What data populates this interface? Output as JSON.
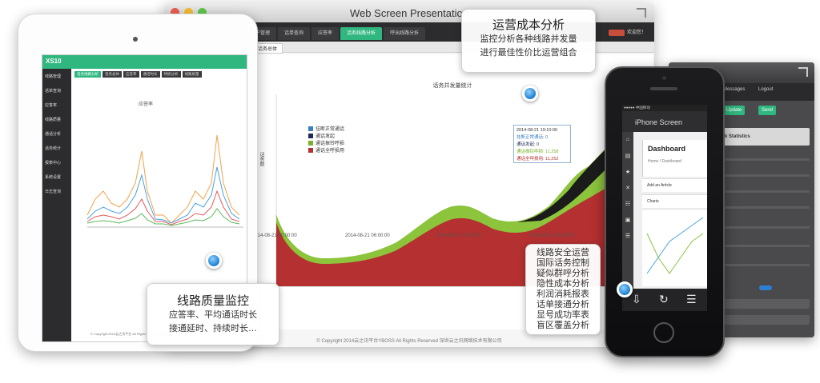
{
  "back_device": {
    "tabs": [
      "Messages",
      "Logout"
    ],
    "buttons": [
      {
        "label": "Update",
        "color": "#2fb77f"
      },
      {
        "label": "Send",
        "color": "#2fb77f"
      }
    ],
    "panel_label": "k Statistics"
  },
  "mac_window": {
    "title": "Web Screen Presentation",
    "nav_tabs": [
      "用户管理",
      "话单查询",
      "应答率",
      "话务线路分析",
      "呼出线路分析"
    ],
    "active_tab": 3,
    "user_label": "欢迎您！",
    "subtab": "话务总体",
    "chart_title": "话务并发量统计",
    "y_label": "话务数",
    "x_ticks": [
      "2014-08-21 00:00:00",
      "2014-08-21 06:00:00",
      "2014-08-21 12:00:00",
      "2014-08-21 18:00:00"
    ],
    "legend": [
      {
        "label": "挂断正常通话",
        "color": "#3c7fc0"
      },
      {
        "label": "通话发起",
        "color": "#1f2a5a"
      },
      {
        "label": "通话振铃呼损",
        "color": "#7bb02c"
      },
      {
        "label": "通话全呼损用",
        "color": "#b53030"
      }
    ],
    "tooltip": {
      "time": "2014-08-21 19:10:00",
      "rows": [
        "挂断正常通话: 0",
        "通话发起: 0",
        "通话振铃呼损: 11,258",
        "通话全呼损用: 11,252"
      ]
    },
    "footer": "© Copyright 2014云之讯平台YBOSS All Rights Reserved 深圳云之讯网络技术有限公司"
  },
  "ipad": {
    "logo": "XS10",
    "tabs": [
      "话务线路分析",
      "话务总体",
      "应答率",
      "通话时长",
      "呼损分析",
      "线路质量",
      "话务对比",
      "地区分析"
    ],
    "sidebar_items": [
      "线路管理",
      "话单查询",
      "应答率",
      "线路质量",
      "通话分析",
      "话务统计",
      "报表中心",
      "系统设置",
      "日志查询"
    ],
    "chart_title": "应答率",
    "footer": "© Copyright 2014云之讯平台 All Rights Reserved 深圳云之讯网络技术有限公司"
  },
  "iphone": {
    "status": "●●●●● 中国移动",
    "brand": "iPhone Screen",
    "header_title": "Dashboard",
    "breadcrumb": "Home / Dashboard",
    "rows": [
      "Add an Article",
      "Charts"
    ],
    "sidebar_icons": [
      "⌂",
      "▤",
      "★",
      "✕",
      "☷",
      "▣",
      "☰"
    ],
    "bottom_icons": [
      "⇩",
      "↻",
      "☰"
    ]
  },
  "callouts": {
    "cost": {
      "title": "运营成本分析",
      "lines": [
        "监控分析各种线路并发量",
        "进行最佳性价比运营组合"
      ]
    },
    "quality": {
      "title": "线路质量监控",
      "lines": [
        "应答率、平均通话时长",
        "接通延时、持续时长…"
      ]
    },
    "security": {
      "lines": [
        "线路安全运营",
        "国际话务控制",
        "疑似群呼分析",
        "隐性成本分析",
        "利润消耗报表",
        "话单接通分析",
        "显号成功率表",
        "盲区覆盖分析"
      ]
    }
  }
}
